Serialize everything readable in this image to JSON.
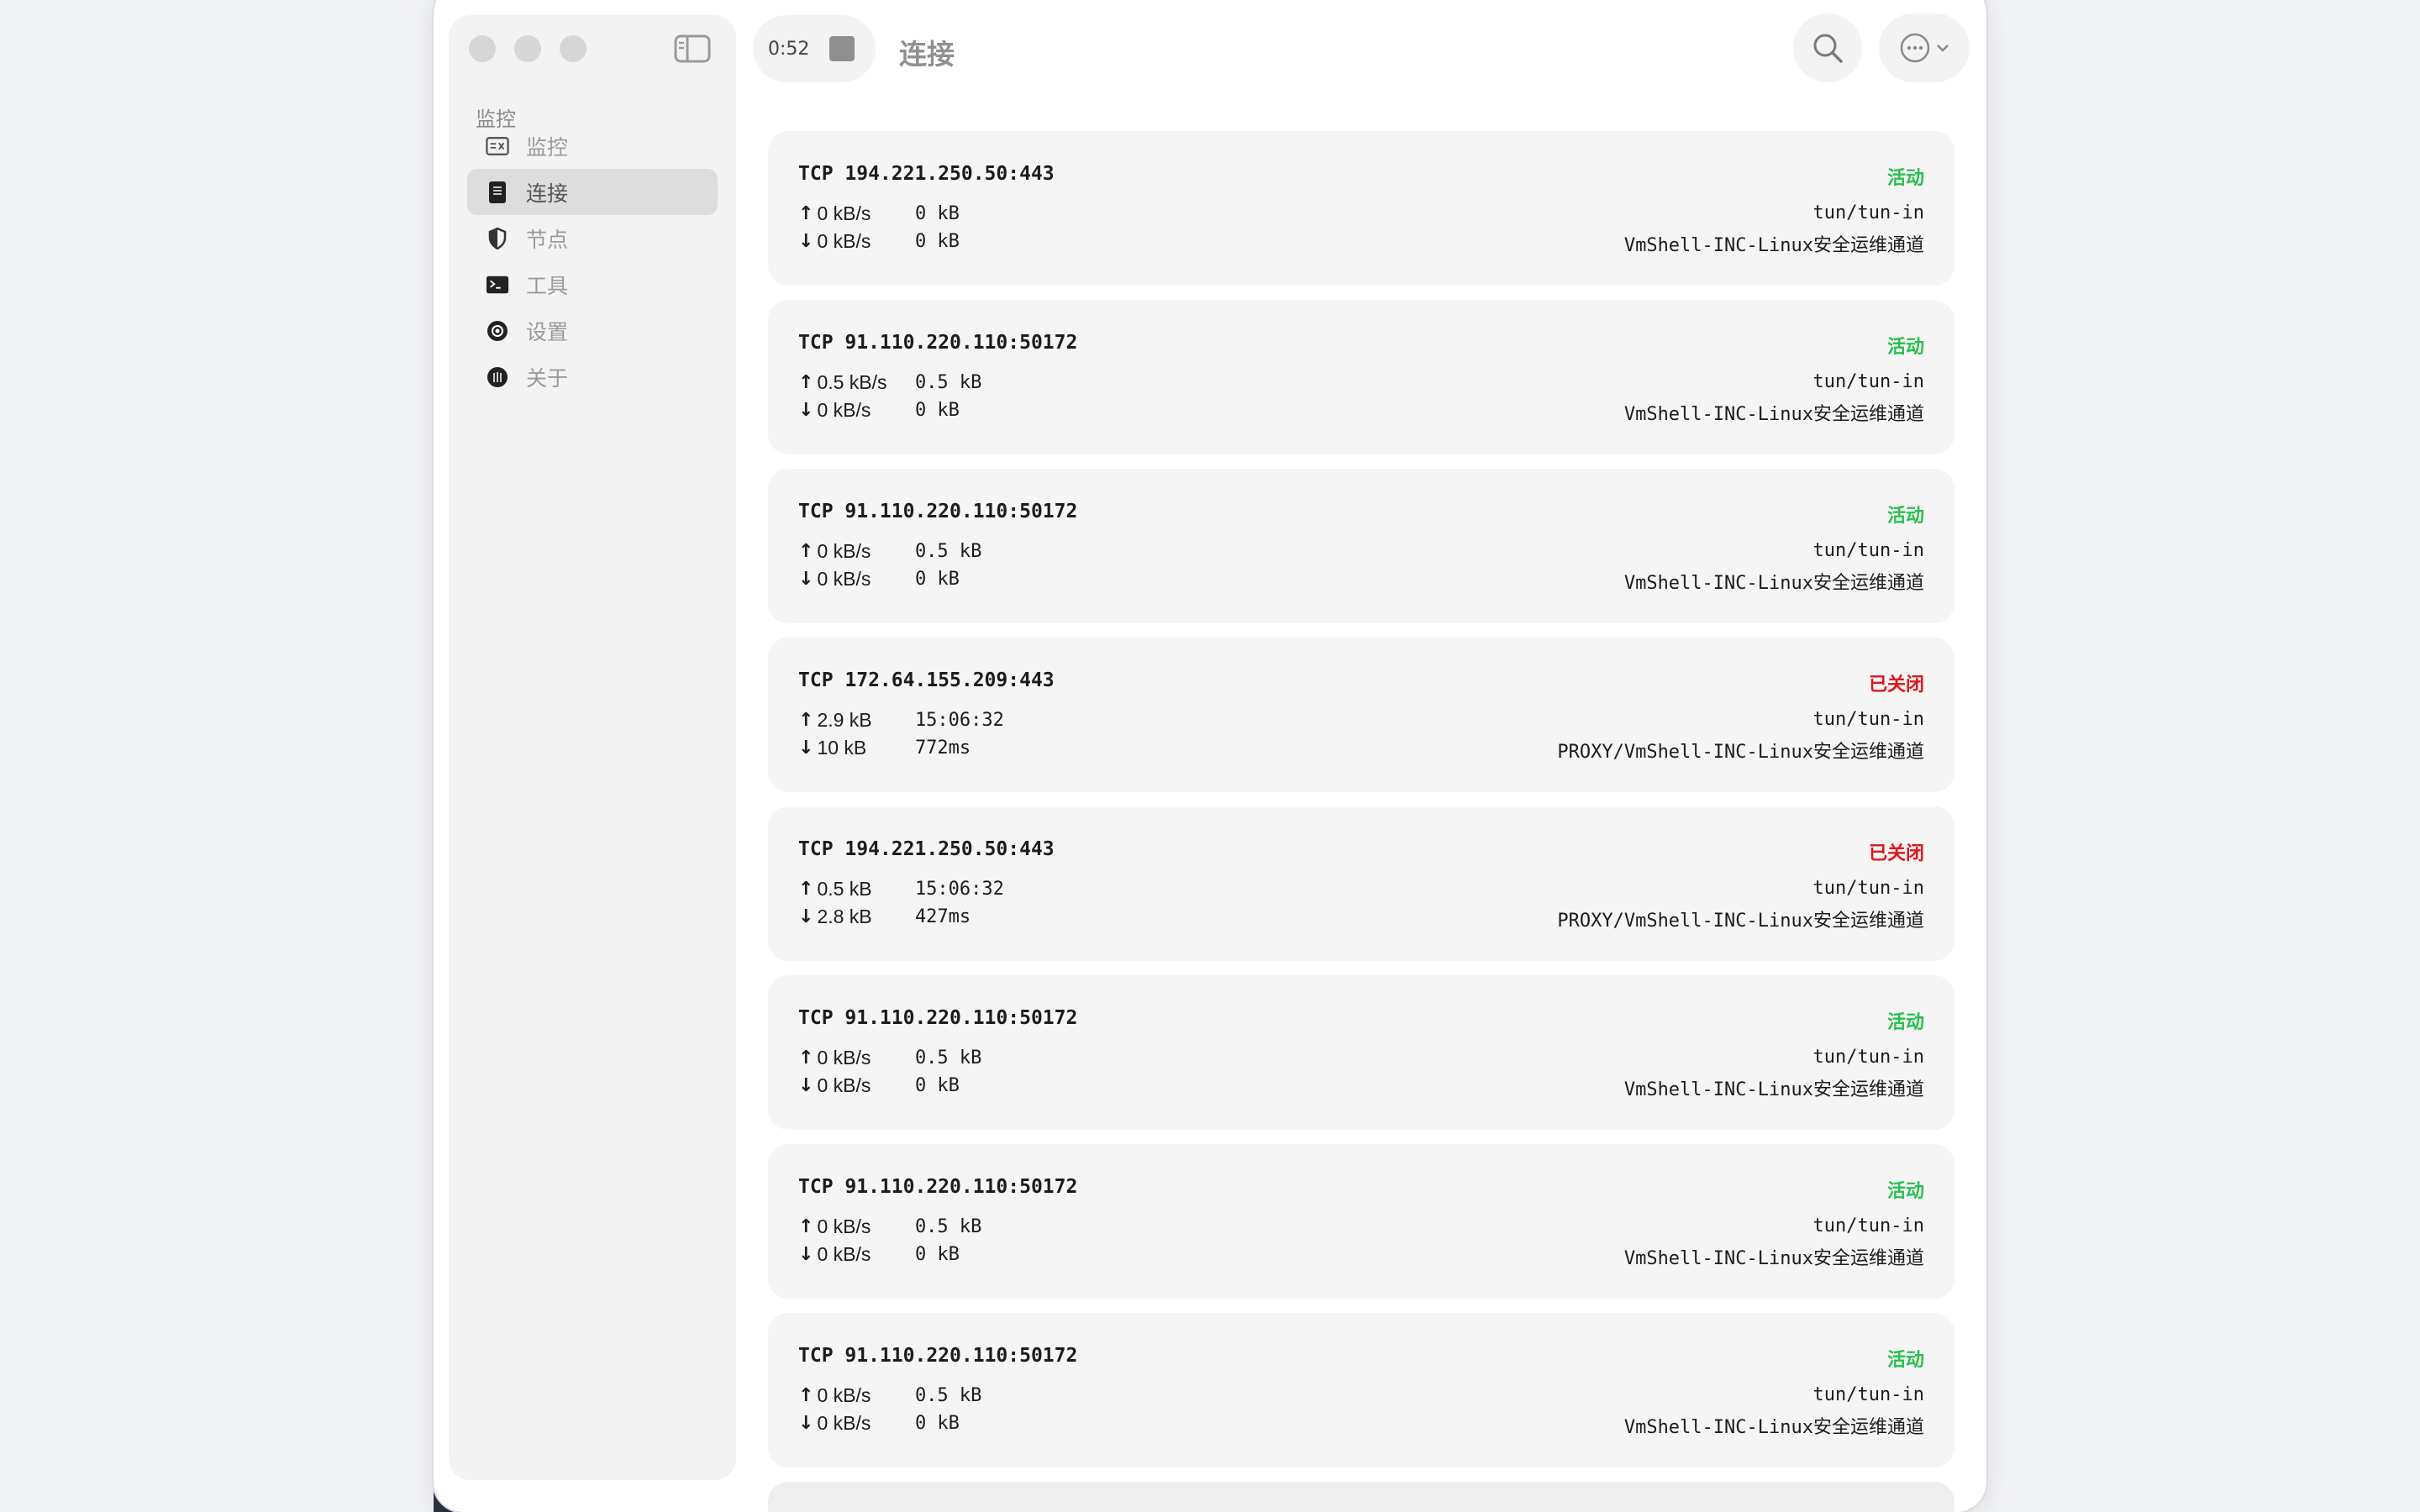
{
  "sidebar": {
    "section_title": "监控",
    "items": [
      {
        "label": "监控",
        "icon": "monitor-icon",
        "active": false
      },
      {
        "label": "连接",
        "icon": "connections-icon",
        "active": true
      },
      {
        "label": "节点",
        "icon": "shield-icon",
        "active": false
      },
      {
        "label": "工具",
        "icon": "terminal-icon",
        "active": false
      },
      {
        "label": "设置",
        "icon": "gear-icon",
        "active": false
      },
      {
        "label": "关于",
        "icon": "about-icon",
        "active": false
      }
    ]
  },
  "header": {
    "timer": "0:52",
    "title": "连接"
  },
  "colors": {
    "active": "#27c04e",
    "closed": "#e0151c"
  },
  "connections": [
    {
      "title": "TCP 194.221.250.50:443",
      "status": "活动",
      "status_type": "active",
      "up_rate": "0 kB/s",
      "up_extra": "0 kB",
      "down_rate": "0 kB/s",
      "down_extra": "0 kB",
      "inbound": "tun/tun-in",
      "chain": "VmShell-INC-Linux安全运维通道"
    },
    {
      "title": "TCP 91.110.220.110:50172",
      "status": "活动",
      "status_type": "active",
      "up_rate": "0.5 kB/s",
      "up_extra": "0.5 kB",
      "down_rate": "0 kB/s",
      "down_extra": "0 kB",
      "inbound": "tun/tun-in",
      "chain": "VmShell-INC-Linux安全运维通道"
    },
    {
      "title": "TCP 91.110.220.110:50172",
      "status": "活动",
      "status_type": "active",
      "up_rate": "0 kB/s",
      "up_extra": "0.5 kB",
      "down_rate": "0 kB/s",
      "down_extra": "0 kB",
      "inbound": "tun/tun-in",
      "chain": "VmShell-INC-Linux安全运维通道"
    },
    {
      "title": "TCP 172.64.155.209:443",
      "status": "已关闭",
      "status_type": "closed",
      "up_rate": "2.9 kB",
      "up_extra": "15:06:32",
      "down_rate": "10 kB",
      "down_extra": "772ms",
      "inbound": "tun/tun-in",
      "chain": "PROXY/VmShell-INC-Linux安全运维通道"
    },
    {
      "title": "TCP 194.221.250.50:443",
      "status": "已关闭",
      "status_type": "closed",
      "up_rate": "0.5 kB",
      "up_extra": "15:06:32",
      "down_rate": "2.8 kB",
      "down_extra": "427ms",
      "inbound": "tun/tun-in",
      "chain": "PROXY/VmShell-INC-Linux安全运维通道"
    },
    {
      "title": "TCP 91.110.220.110:50172",
      "status": "活动",
      "status_type": "active",
      "up_rate": "0 kB/s",
      "up_extra": "0.5 kB",
      "down_rate": "0 kB/s",
      "down_extra": "0 kB",
      "inbound": "tun/tun-in",
      "chain": "VmShell-INC-Linux安全运维通道"
    },
    {
      "title": "TCP 91.110.220.110:50172",
      "status": "活动",
      "status_type": "active",
      "up_rate": "0 kB/s",
      "up_extra": "0.5 kB",
      "down_rate": "0 kB/s",
      "down_extra": "0 kB",
      "inbound": "tun/tun-in",
      "chain": "VmShell-INC-Linux安全运维通道"
    },
    {
      "title": "TCP 91.110.220.110:50172",
      "status": "活动",
      "status_type": "active",
      "up_rate": "0 kB/s",
      "up_extra": "0.5 kB",
      "down_rate": "0 kB/s",
      "down_extra": "0 kB",
      "inbound": "tun/tun-in",
      "chain": "VmShell-INC-Linux安全运维通道"
    }
  ]
}
